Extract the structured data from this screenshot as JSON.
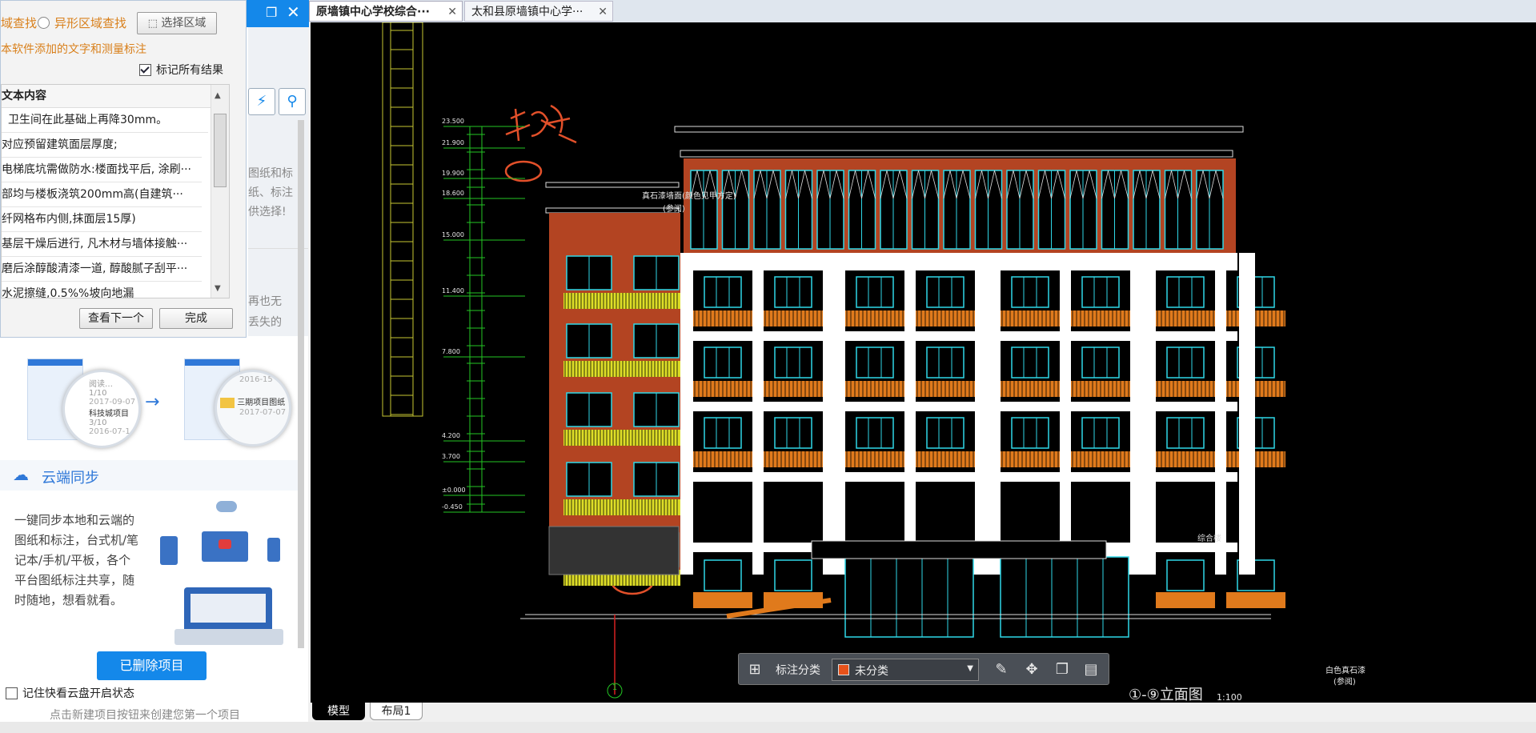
{
  "find_panel": {
    "opt_search_left": "域查找",
    "opt_irregular": "异形区域查找",
    "select_region": "选择区域",
    "note": "本软件添加的文字和测量标注",
    "mark_all": "标记所有结果",
    "list_header": "文本内容",
    "results": [
      "卫生间在此基础上再降30mm。",
      "对应预留建筑面层厚度;",
      "电梯底坑需做防水:楼面找平后, 涂刷···",
      "部均与楼板浇筑200mm高(自建筑···",
      "纤网格布内侧,抹面层15厚)",
      "基层干燥后进行, 凡木材与墙体接触···",
      "磨后涂醇酸清漆一道, 醇酸腻子刮平···",
      "水泥擦缝,0.5%%坡向地漏"
    ],
    "next_btn": "查看下一个",
    "done_btn": "完成"
  },
  "behind_text": {
    "frag1": "图纸和标",
    "frag2": "纸、标注",
    "frag3": "供选择!",
    "frag4": "再也无",
    "frag5": "丢失的"
  },
  "illus": {
    "card1_title": "阅读…",
    "card1_meta1": "1/10",
    "card1_date1": "2017-09-07",
    "card1_name2": "科技城项目",
    "card1_meta2": "3/10",
    "card1_date2": "2016-07-1",
    "card2_date": "2016-15",
    "card2_name": "三期项目图纸",
    "card2_date2": "2017-07-07"
  },
  "cloud": {
    "title": "云端同步",
    "desc": "一键同步本地和云端的图纸和标注，台式机/笔记本/手机/平板，各个平台图纸标注共享，随时随地，想看就看。"
  },
  "deleted_btn": "已删除项目",
  "remember_label": "记住快看云盘开启状态",
  "create_hint": "点击新建项目按钮来创建您第一个项目",
  "tabs": [
    {
      "label": "原墙镇中心学校综合···"
    },
    {
      "label": "太和县原墙镇中心学···"
    }
  ],
  "layout_tabs": {
    "model": "模型",
    "layout1": "布局1"
  },
  "toolbar": {
    "label": "标注分类",
    "category": "未分类",
    "category_color": "#e8521a"
  },
  "cad_text": {
    "handwriting": "楼梯",
    "elev_title": "①-⑨立面图",
    "scale": "1:100",
    "circle_label": "1",
    "sign": "综合楼",
    "note1": "真石漆墙面(颜色见甲方定)",
    "note1b": "(参阅)",
    "note2": "白色真石漆",
    "note2b": "(参阅)",
    "levels": [
      "23.500",
      "21.900",
      "19.900",
      "18.600",
      "15.000",
      "11.400",
      "7.800",
      "4.200",
      "3.700",
      "±0.000",
      "-0.450"
    ]
  },
  "colors": {
    "accent": "#1488ea",
    "cad_bg": "#000000",
    "brick": "#b34422",
    "window": "#2fd8e8",
    "dim_green": "#23c623",
    "rail_yellow": "#dede27",
    "rail_orange": "#e07a1c"
  }
}
